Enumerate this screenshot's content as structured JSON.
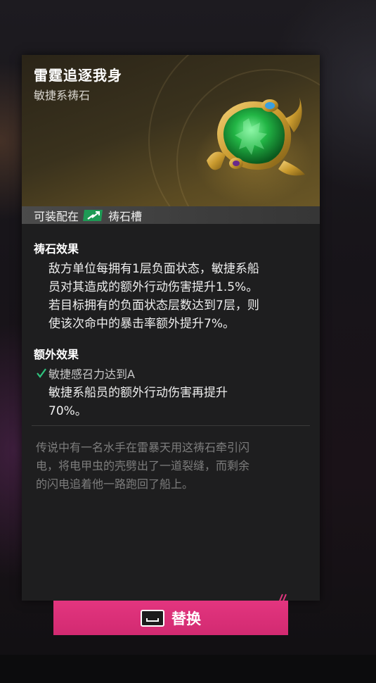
{
  "card": {
    "title": "雷霆追逐我身",
    "subtitle": "敏捷系祷石",
    "gem_icon": "green-gem-amulet-icon",
    "slot_prefix": "可装配在",
    "slot_icon": "agility-slot-icon",
    "slot_suffix": "祷石槽"
  },
  "effect": {
    "title": "祷石效果",
    "lines": [
      "敌方单位每拥有1层负面状态，敏捷系船",
      "员对其造成的额外行动伤害提升1.5%。",
      "若目标拥有的负面状态层数达到7层，则",
      "使该次命中的暴击率额外提升7%。"
    ]
  },
  "bonus": {
    "title": "额外效果",
    "condition": "敏捷感召力达到A",
    "condition_icon": "check-icon",
    "lines": [
      "敏捷系船员的额外行动伤害再提升",
      "70%。"
    ]
  },
  "lore": {
    "lines": [
      "传说中有一名水手在雷暴天用这祷石牵引闪",
      "电，将电甲虫的壳劈出了一道裂缝，而剩余",
      "的闪电追着他一路跑回了船上。"
    ]
  },
  "button": {
    "label": "替换",
    "key_icon": "spacebar-key-icon"
  },
  "colors": {
    "accent": "#d92d76",
    "gem_green": "#1ea93a",
    "gold": "#c99a2e",
    "check": "#2fc47e"
  }
}
